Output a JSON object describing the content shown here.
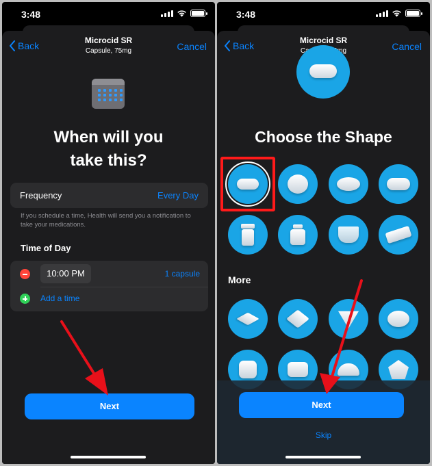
{
  "status_bar": {
    "time": "3:48"
  },
  "left_screen": {
    "nav": {
      "back": "Back",
      "title": "Microcid SR",
      "subtitle": "Capsule, 75mg",
      "cancel": "Cancel"
    },
    "heading_line1": "When will you",
    "heading_line2": "take this?",
    "frequency": {
      "label": "Frequency",
      "value": "Every Day"
    },
    "hint": "If you schedule a time, Health will send you a notification to take your medications.",
    "time_of_day": {
      "title": "Time of Day",
      "time": "10:00 PM",
      "dose": "1 capsule",
      "add_time": "Add a time"
    },
    "next": "Next"
  },
  "right_screen": {
    "nav": {
      "back": "Back",
      "title": "Microcid SR",
      "subtitle": "Capsule, 75mg",
      "cancel": "Cancel"
    },
    "heading": "Choose the Shape",
    "more": "More",
    "next": "Next",
    "skip": "Skip"
  },
  "colors": {
    "accent": "#0a84ff",
    "shape_bg": "#1aa5e6",
    "highlight": "#ff1a1a",
    "annotation_arrow": "#e8101a"
  }
}
